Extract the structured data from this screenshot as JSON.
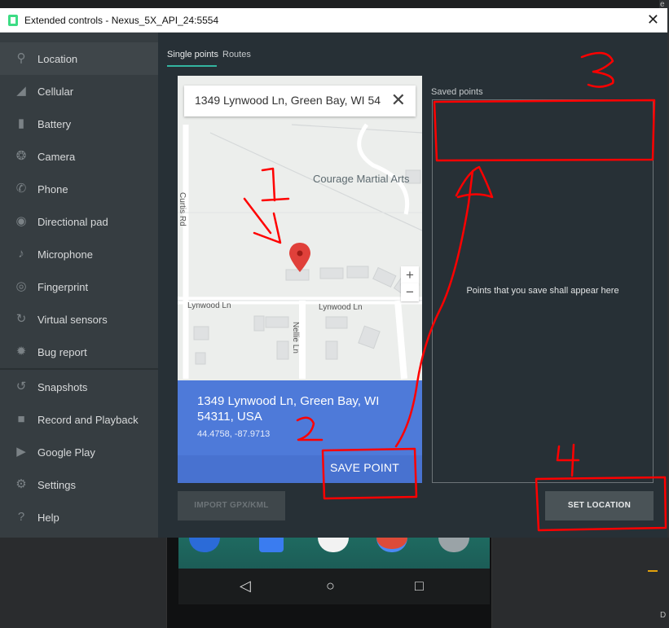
{
  "window": {
    "title": "Extended controls - Nexus_5X_API_24:5554",
    "close_glyph": "✕"
  },
  "sidebar": {
    "items": [
      {
        "label": "Location",
        "icon": "location-pin-icon",
        "glyph": "⚲",
        "active": true
      },
      {
        "label": "Cellular",
        "icon": "cellular-signal-icon",
        "glyph": "◢"
      },
      {
        "label": "Battery",
        "icon": "battery-icon",
        "glyph": "▮"
      },
      {
        "label": "Camera",
        "icon": "camera-aperture-icon",
        "glyph": "❂"
      },
      {
        "label": "Phone",
        "icon": "phone-icon",
        "glyph": "✆"
      },
      {
        "label": "Directional pad",
        "icon": "dpad-icon",
        "glyph": "◉"
      },
      {
        "label": "Microphone",
        "icon": "microphone-icon",
        "glyph": "♪"
      },
      {
        "label": "Fingerprint",
        "icon": "fingerprint-icon",
        "glyph": "◎"
      },
      {
        "label": "Virtual sensors",
        "icon": "virtual-sensors-icon",
        "glyph": "↻"
      },
      {
        "label": "Bug report",
        "icon": "bug-icon",
        "glyph": "✹"
      },
      {
        "label": "Snapshots",
        "icon": "history-icon",
        "glyph": "↺"
      },
      {
        "label": "Record and Playback",
        "icon": "videocam-icon",
        "glyph": "■"
      },
      {
        "label": "Google Play",
        "icon": "google-play-icon",
        "glyph": "▶"
      },
      {
        "label": "Settings",
        "icon": "gear-icon",
        "glyph": "⚙"
      },
      {
        "label": "Help",
        "icon": "help-icon",
        "glyph": "?"
      }
    ]
  },
  "tabs": [
    {
      "label": "Single points",
      "active": true
    },
    {
      "label": "Routes",
      "active": false
    }
  ],
  "map": {
    "search_value": "1349 Lynwood Ln, Green Bay, WI 54",
    "clear_glyph": "✕",
    "poi": "Courage Martial Arts",
    "streets": [
      "Lynwood Ln",
      "Lynwood Ln",
      "Nellie Ln",
      "Curtis Rd"
    ],
    "zoom_in": "+",
    "zoom_out": "−",
    "selected_address": "1349 Lynwood Ln, Green Bay, WI 54311, USA",
    "selected_coords": "44.4758, -87.9713",
    "save_button": "SAVE POINT"
  },
  "saved_points": {
    "label": "Saved points",
    "empty_text": "Points that you save shall appear here"
  },
  "buttons": {
    "import": "IMPORT GPX/KML",
    "set_location": "SET LOCATION"
  },
  "phone_nav": {
    "back": "◁",
    "home": "○",
    "recents": "□"
  },
  "annotations": {
    "color": "#ff0000",
    "numbers": [
      "1",
      "2",
      "3",
      "4"
    ]
  },
  "colors": {
    "accent": "#33b5a0",
    "panel_blue": "#4e7ad9",
    "map_pin": "#e0403a",
    "background": "#273036"
  }
}
